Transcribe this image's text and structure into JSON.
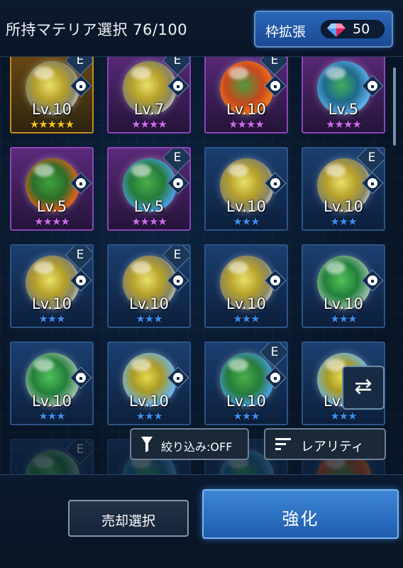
{
  "header": {
    "title": "所持マテリア選択 76/100",
    "expand_label": "枠拡張",
    "gem_count": "50"
  },
  "materia": [
    {
      "level": "Lv.10",
      "stars": "★★★★★",
      "frame": "gold",
      "star_color": "#f5c31c",
      "orb": "yellow",
      "equipped": true,
      "locked": true
    },
    {
      "level": "Lv.7",
      "stars": "★★★★",
      "frame": "purple",
      "star_color": "#d26bf0",
      "orb": "yellow",
      "equipped": true,
      "locked": true
    },
    {
      "level": "Lv.10",
      "stars": "★★★★",
      "frame": "purple",
      "star_color": "#d26bf0",
      "orb": "red",
      "equipped": true,
      "locked": true
    },
    {
      "level": "Lv.5",
      "stars": "★★★★",
      "frame": "purple",
      "star_color": "#d26bf0",
      "orb": "blue",
      "equipped": false,
      "locked": true
    },
    {
      "level": "Lv.5",
      "stars": "★★★★",
      "frame": "purple",
      "star_color": "#d26bf0",
      "orb": "green-red",
      "equipped": false,
      "locked": true
    },
    {
      "level": "Lv.5",
      "stars": "★★★★",
      "frame": "purple",
      "star_color": "#d26bf0",
      "orb": "green-blue",
      "equipped": true,
      "locked": true
    },
    {
      "level": "Lv.10",
      "stars": "★★★",
      "frame": "blue",
      "star_color": "#3b8ff0",
      "orb": "yellow",
      "equipped": false,
      "locked": true
    },
    {
      "level": "Lv.10",
      "stars": "★★★",
      "frame": "blue",
      "star_color": "#3b8ff0",
      "orb": "yellow",
      "equipped": true,
      "locked": true
    },
    {
      "level": "Lv.10",
      "stars": "★★★",
      "frame": "blue",
      "star_color": "#3b8ff0",
      "orb": "yellow",
      "equipped": true,
      "locked": true
    },
    {
      "level": "Lv.10",
      "stars": "★★★",
      "frame": "blue",
      "star_color": "#3b8ff0",
      "orb": "yellow",
      "equipped": true,
      "locked": true
    },
    {
      "level": "Lv.10",
      "stars": "★★★",
      "frame": "blue",
      "star_color": "#3b8ff0",
      "orb": "yellow",
      "equipped": false,
      "locked": true
    },
    {
      "level": "Lv.10",
      "stars": "★★★",
      "frame": "blue",
      "star_color": "#3b8ff0",
      "orb": "green",
      "equipped": false,
      "locked": true
    },
    {
      "level": "Lv.10",
      "stars": "★★★",
      "frame": "blue",
      "star_color": "#3b8ff0",
      "orb": "green",
      "equipped": false,
      "locked": true
    },
    {
      "level": "Lv.10",
      "stars": "★★★",
      "frame": "blue",
      "star_color": "#3b8ff0",
      "orb": "yellow-blue",
      "equipped": false,
      "locked": true
    },
    {
      "level": "Lv.10",
      "stars": "★★★",
      "frame": "blue",
      "star_color": "#3b8ff0",
      "orb": "green-blue",
      "equipped": true,
      "locked": true
    },
    {
      "level": "Lv.10",
      "stars": "★★★",
      "frame": "blue",
      "star_color": "#3b8ff0",
      "orb": "yellow-blue",
      "equipped": false,
      "locked": true
    },
    {
      "level": "",
      "stars": "",
      "frame": "blue",
      "star_color": "#3b8ff0",
      "orb": "green",
      "equipped": true,
      "locked": false
    },
    {
      "level": "",
      "stars": "",
      "frame": "blue",
      "star_color": "#3b8ff0",
      "orb": "blue",
      "equipped": false,
      "locked": false
    },
    {
      "level": "",
      "stars": "",
      "frame": "blue",
      "star_color": "#3b8ff0",
      "orb": "blue",
      "equipped": false,
      "locked": false
    },
    {
      "level": "",
      "stars": "",
      "frame": "blue",
      "star_color": "#3b8ff0",
      "orb": "red",
      "equipped": false,
      "locked": false
    }
  ],
  "toolbar": {
    "filter_label": "絞り込み:OFF",
    "sort_label": "レアリティ"
  },
  "footer": {
    "sell_label": "売却選択",
    "enhance_label": "強化"
  }
}
